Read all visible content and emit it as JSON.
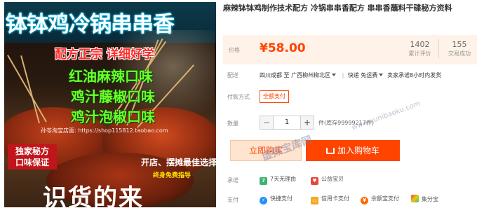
{
  "image": {
    "banner_title": "钵钵鸡冷锅串串香",
    "slogan": "配方正宗  详细好学",
    "flavors": [
      "红油麻辣口味",
      "鸡汁藤椒口味",
      "鸡汁泡椒口味"
    ],
    "shop_link": "孙苓淘宝店面: https://shop115812.taobao.com",
    "secret_line1": "独家秘方",
    "secret_line2": "口味保证",
    "shop_promo": "开店、摆摊最佳选择",
    "guide": "终身免费指导",
    "bottom_text": "识货的来"
  },
  "product": {
    "title": "麻辣钵钵鸡制作技术配方 冷锅串串香配方 串串香蘸料干碟秘方资料"
  },
  "price": {
    "label": "价格",
    "value": "¥58.00",
    "reviews_count": "1402",
    "reviews_label": "累计评价",
    "sales_count": "155",
    "sales_label": "交易成功"
  },
  "shipping": {
    "label": "配送",
    "origin": "四川成都",
    "to": "至",
    "destination": "广西柳州柳北区",
    "method": "快递 免运费",
    "promise": "卖家承诺8小时内发货"
  },
  "payment_method": {
    "label": "付款方式",
    "option": "全额支付"
  },
  "quantity": {
    "label": "数量",
    "minus": "−",
    "value": "1",
    "plus": "+",
    "stock": "件(库存99999217件)"
  },
  "actions": {
    "buy_now": "立即购买",
    "add_to_cart": "加入购物车"
  },
  "guarantee": {
    "label": "承诺",
    "items": [
      "7天无理由",
      "公益宝贝"
    ]
  },
  "pay": {
    "label": "支付",
    "items": [
      "快捷支付",
      "信用卡支付",
      "余额宝支付",
      "集分宝"
    ]
  },
  "watermark": {
    "text": "虚拟宝库网",
    "url": "www.xunibaoku.com"
  },
  "colors": {
    "accent": "#ff4400",
    "price_bg": "#fff2e8",
    "buy_bg": "#ffe4d0"
  }
}
